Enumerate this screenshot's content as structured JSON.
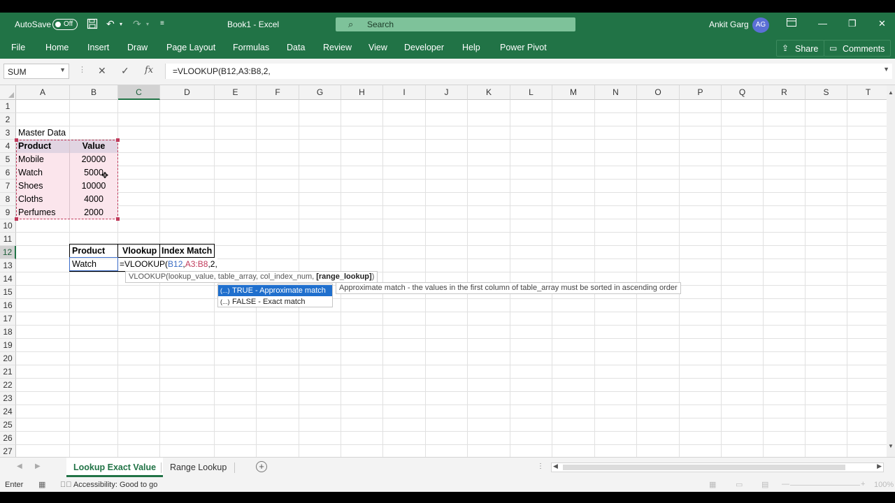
{
  "titlebar": {
    "autosave_label": "AutoSave",
    "autosave_state": "Off",
    "doc_title": "Book1  -  Excel",
    "search_placeholder": "Search",
    "user_name": "Ankit Garg",
    "user_initials": "AG"
  },
  "ribbon": {
    "tabs": [
      "File",
      "Home",
      "Insert",
      "Draw",
      "Page Layout",
      "Formulas",
      "Data",
      "Review",
      "View",
      "Developer",
      "Help",
      "Power Pivot"
    ],
    "share_label": "Share",
    "comments_label": "Comments"
  },
  "formula_bar": {
    "name_box": "SUM",
    "formula": "=VLOOKUP(B12,A3:B8,2,"
  },
  "columns": [
    "A",
    "B",
    "C",
    "D",
    "E",
    "F",
    "G",
    "H",
    "I",
    "J",
    "K",
    "L",
    "M",
    "N",
    "O",
    "P",
    "Q",
    "R",
    "S",
    "T"
  ],
  "selected_column": "C",
  "rows": [
    "1",
    "2",
    "3",
    "4",
    "5",
    "6",
    "7",
    "8",
    "9",
    "10",
    "11",
    "12",
    "13",
    "14",
    "15",
    "16",
    "17",
    "18",
    "19",
    "20",
    "21",
    "22",
    "23",
    "24",
    "25",
    "26",
    "27"
  ],
  "selected_row": "12",
  "sheet": {
    "master_title": "Master Data",
    "master_headers": [
      "Product",
      "Value"
    ],
    "master_rows": [
      {
        "product": "Mobile",
        "value": "20000"
      },
      {
        "product": "Watch",
        "value": "5000"
      },
      {
        "product": "Shoes",
        "value": "10000"
      },
      {
        "product": "Cloths",
        "value": "4000"
      },
      {
        "product": "Perfumes",
        "value": "2000"
      }
    ],
    "lookup_headers": [
      "Product",
      "Vlookup",
      "Index Match"
    ],
    "lookup_product": "Watch",
    "formula_parts": {
      "prefix": "=VLOOKUP(",
      "ref1": "B12",
      "comma1": ",",
      "ref2": "A3:B8",
      "suffix": ",2,"
    }
  },
  "autocomplete": {
    "tooltip_prefix": "VLOOKUP(lookup_value, table_array, col_index_num, ",
    "tooltip_bold": "[range_lookup]",
    "tooltip_suffix": ")",
    "options": [
      "TRUE - Approximate match",
      "FALSE - Exact match"
    ],
    "option_icon": "(...)",
    "hint": "Approximate match - the values in the first column of table_array must be sorted in ascending order"
  },
  "sheet_tabs": [
    "Lookup Exact Value",
    "Range Lookup"
  ],
  "active_sheet": "Lookup Exact Value",
  "status": {
    "mode": "Enter",
    "accessibility": "Accessibility: Good to go",
    "zoom": "100%"
  },
  "colors": {
    "excel_green": "#217346",
    "header_fill": "#e1d4e2",
    "data_fill": "#fbe5ec",
    "range_ref_red": "#c0395a",
    "cell_ref_blue": "#3b6dc4",
    "selection_blue": "#1f6fcd"
  }
}
